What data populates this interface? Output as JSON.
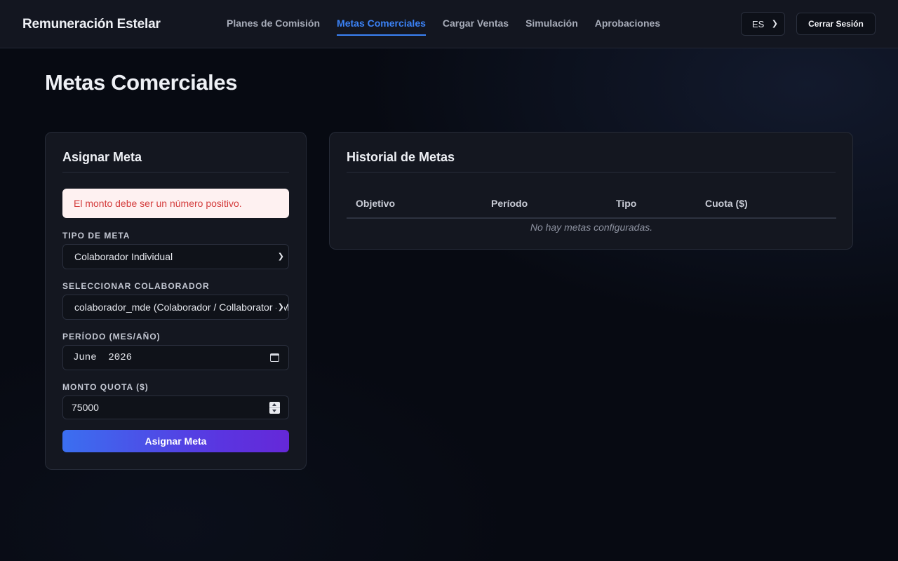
{
  "app": {
    "title": "Remuneración Estelar"
  },
  "nav": {
    "items": [
      {
        "label": "Planes de Comisión",
        "active": false
      },
      {
        "label": "Metas Comerciales",
        "active": true
      },
      {
        "label": "Cargar Ventas",
        "active": false
      },
      {
        "label": "Simulación",
        "active": false
      },
      {
        "label": "Aprobaciones",
        "active": false
      }
    ]
  },
  "header": {
    "language_value": "ES",
    "logout_label": "Cerrar Sesión"
  },
  "page": {
    "title": "Metas Comerciales"
  },
  "assign_form": {
    "title": "Asignar Meta",
    "error_message": "El monto debe ser un número positivo.",
    "goal_type": {
      "label": "TIPO DE META",
      "value": "Colaborador Individual"
    },
    "collaborator": {
      "label": "SELECCIONAR COLABORADOR",
      "value": "colaborador_mde (Colaborador / Collaborator - MDE)"
    },
    "period": {
      "label": "PERÍODO (MES/AÑO)",
      "value": "June  2026"
    },
    "quota": {
      "label": "MONTO QUOTA ($)",
      "value": "75000"
    },
    "submit_label": "Asignar Meta"
  },
  "history": {
    "title": "Historial de Metas",
    "columns": [
      "Objetivo",
      "Período",
      "Tipo",
      "Cuota ($)"
    ],
    "empty_message": "No hay metas configuradas."
  },
  "colors": {
    "accent": "#3b82f6",
    "error_text": "#d43d3d",
    "error_bg": "#fef1f1",
    "button_gradient_start": "#3b6ff0",
    "button_gradient_end": "#6528d8"
  }
}
